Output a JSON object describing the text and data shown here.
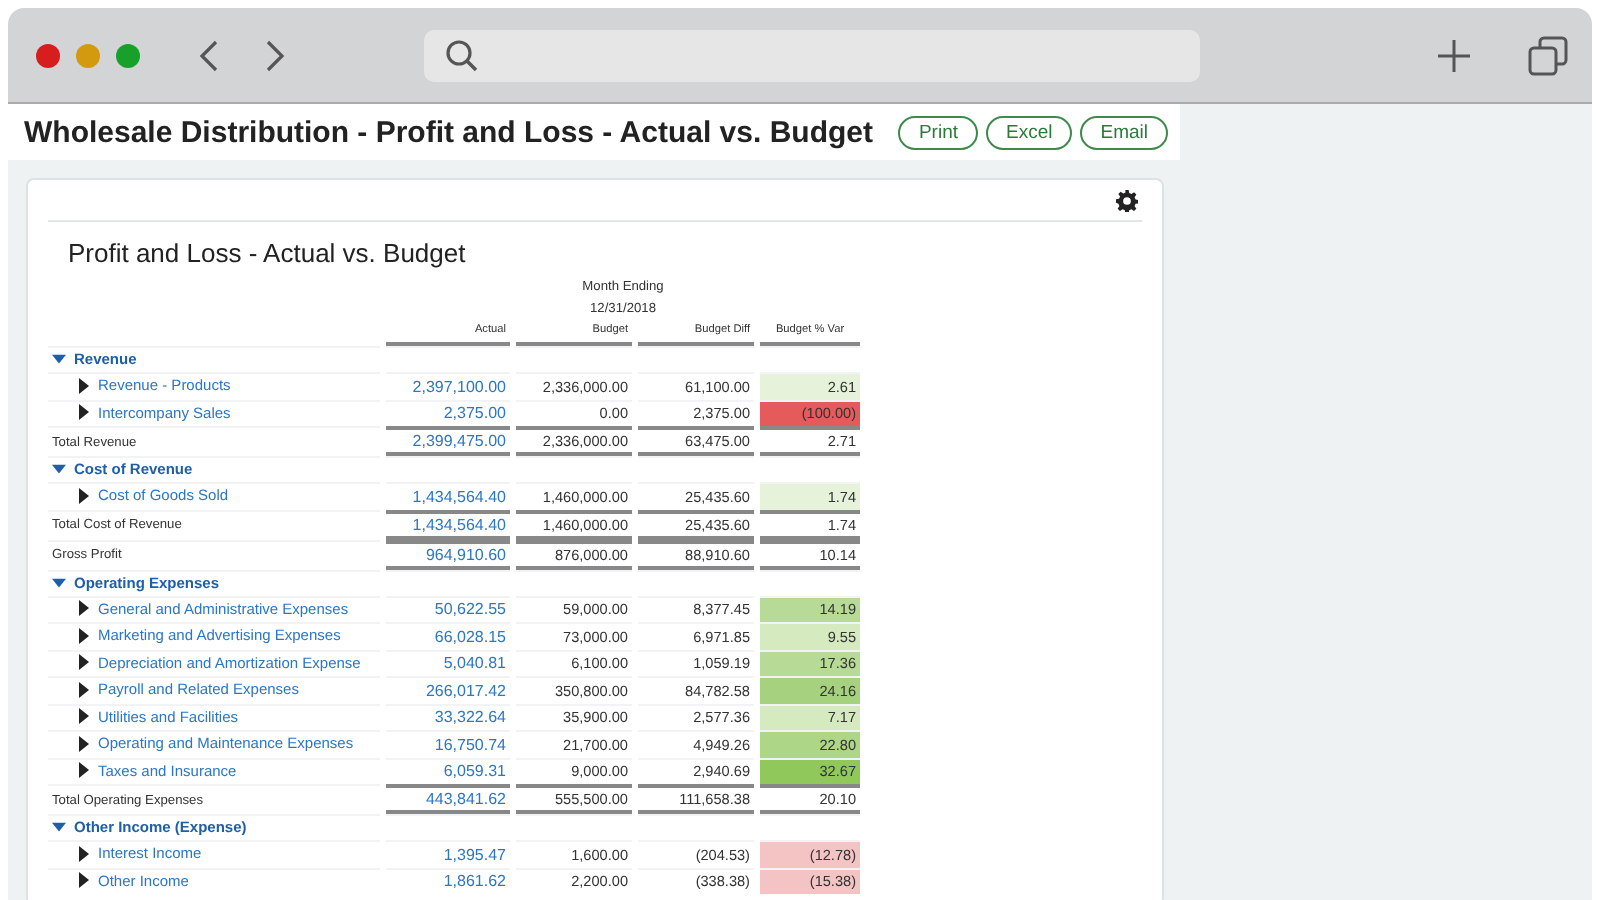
{
  "page_title": "Wholesale Distribution - Profit and Loss - Actual vs. Budget",
  "actions": [
    "Print",
    "Excel",
    "Email"
  ],
  "report": {
    "title": "Profit and Loss - Actual vs. Budget",
    "period_label": "Month Ending",
    "period": "12/31/2018",
    "columns": [
      "Actual",
      "Budget",
      "Budget Diff",
      "Budget % Var"
    ],
    "groups": [
      {
        "kind": "section",
        "label": "Revenue",
        "expanded": true,
        "children": [
          {
            "label": "Revenue - Products",
            "expanded": false,
            "values": [
              "2,397,100.00",
              "2,336,000.00",
              "61,100.00",
              "2.61"
            ],
            "color": "#e6f2d9"
          },
          {
            "label": "Intercompany Sales",
            "expanded": false,
            "values": [
              "2,375.00",
              "0.00",
              "2,375.00",
              "(100.00)"
            ],
            "color": "#e55a5a"
          }
        ]
      },
      {
        "kind": "total",
        "label": "Total Revenue",
        "values": [
          "2,399,475.00",
          "2,336,000.00",
          "63,475.00",
          "2.71"
        ]
      },
      {
        "kind": "section",
        "label": "Cost of Revenue",
        "expanded": true,
        "children": [
          {
            "label": "Cost of Goods Sold",
            "expanded": false,
            "values": [
              "1,434,564.40",
              "1,460,000.00",
              "25,435.60",
              "1.74"
            ],
            "color": "#e6f2d9"
          }
        ]
      },
      {
        "kind": "total",
        "label": "Total Cost of Revenue",
        "values": [
          "1,434,564.40",
          "1,460,000.00",
          "25,435.60",
          "1.74"
        ]
      },
      {
        "kind": "total",
        "label": "Gross Profit",
        "values": [
          "964,910.60",
          "876,000.00",
          "88,910.60",
          "10.14"
        ]
      },
      {
        "kind": "section",
        "label": "Operating Expenses",
        "expanded": true,
        "children": [
          {
            "label": "General and Administrative Expenses",
            "expanded": false,
            "values": [
              "50,622.55",
              "59,000.00",
              "8,377.45",
              "14.19"
            ],
            "color": "#b7db97"
          },
          {
            "label": "Marketing and Advertising Expenses",
            "expanded": false,
            "values": [
              "66,028.15",
              "73,000.00",
              "6,971.85",
              "9.55"
            ],
            "color": "#d5eabf"
          },
          {
            "label": "Depreciation and Amortization Expense",
            "expanded": false,
            "values": [
              "5,040.81",
              "6,100.00",
              "1,059.19",
              "17.36"
            ],
            "color": "#b7db97"
          },
          {
            "label": "Payroll and Related Expenses",
            "expanded": false,
            "values": [
              "266,017.42",
              "350,800.00",
              "84,782.58",
              "24.16"
            ],
            "color": "#a6d27f"
          },
          {
            "label": "Utilities and Facilities",
            "expanded": false,
            "values": [
              "33,322.64",
              "35,900.00",
              "2,577.36",
              "7.17"
            ],
            "color": "#d5eabf"
          },
          {
            "label": "Operating and Maintenance Expenses",
            "expanded": false,
            "values": [
              "16,750.74",
              "21,700.00",
              "4,949.26",
              "22.80"
            ],
            "color": "#add686"
          },
          {
            "label": "Taxes and Insurance",
            "expanded": false,
            "values": [
              "6,059.31",
              "9,000.00",
              "2,940.69",
              "32.67"
            ],
            "color": "#90c85c"
          }
        ]
      },
      {
        "kind": "total",
        "label": "Total Operating Expenses",
        "values": [
          "443,841.62",
          "555,500.00",
          "111,658.38",
          "20.10"
        ]
      },
      {
        "kind": "section",
        "label": "Other Income (Expense)",
        "expanded": true,
        "children": [
          {
            "label": "Interest Income",
            "expanded": false,
            "values": [
              "1,395.47",
              "1,600.00",
              "(204.53)",
              "(12.78)"
            ],
            "color": "#f4c4c4"
          },
          {
            "label": "Other Income",
            "expanded": false,
            "values": [
              "1,861.62",
              "2,200.00",
              "(338.38)",
              "(15.38)"
            ],
            "color": "#f4c4c4"
          }
        ]
      }
    ]
  }
}
